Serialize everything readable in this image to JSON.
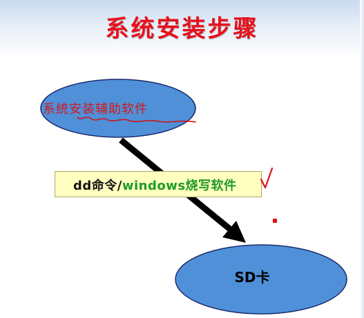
{
  "slide": {
    "title": "系统安装步骤",
    "colors": {
      "title": "#e8101a",
      "ellipse_fill": "#4f90d9",
      "ellipse_stroke": "#1b2a6b",
      "highlight_box": "#ffffc0",
      "green_text": "#1f9b28",
      "annotation_red": "#e01010"
    }
  },
  "diagram": {
    "top_node": {
      "label": "系统安装辅助软件"
    },
    "bottom_node": {
      "label": "SD卡"
    },
    "edge": {
      "label_part1": "dd命令/",
      "label_part2": "windows烧写软件"
    },
    "annotations": {
      "check_mark_icon": "red-checkmark",
      "underline": "red-wavy-underline"
    }
  }
}
